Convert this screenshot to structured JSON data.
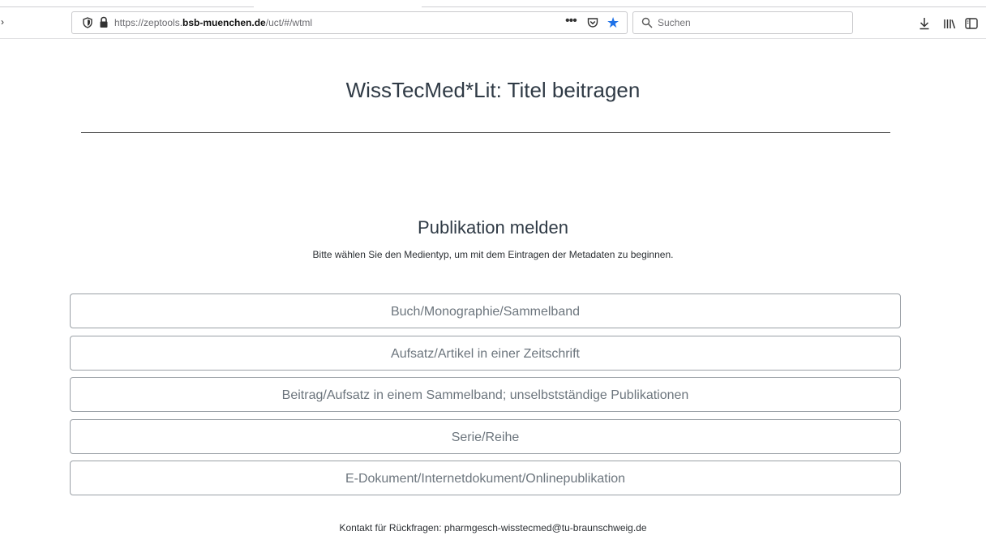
{
  "browser": {
    "url_prefix": "https://zeptools.",
    "url_domain": "bsb-muenchen.de",
    "url_path": "/uct/#/wtml",
    "more_label": "•••",
    "search_placeholder": "Suchen",
    "colors": {
      "star": "#1f72e8"
    }
  },
  "page": {
    "title": "WissTecMed*Lit: Titel beitragen",
    "section_title": "Publikation melden",
    "section_subtitle": "Bitte wählen Sie den Medientyp, um mit dem Eintragen der Metadaten zu beginnen.",
    "options": [
      "Buch/Monographie/Sammelband",
      "Aufsatz/Artikel in einer Zeitschrift",
      "Beitrag/Aufsatz in einem Sammelband; unselbstständige Publikationen",
      "Serie/Reihe",
      "E-Dokument/Internetdokument/Onlinepublikation"
    ],
    "footer": "Kontakt für Rückfragen: pharmgesch-wisstecmed@tu-braunschweig.de"
  },
  "icons": [
    "back-icon",
    "shield-icon",
    "lock-icon",
    "more-icon",
    "pocket-icon",
    "star-icon",
    "search-icon",
    "download-icon",
    "library-icon",
    "sidebar-icon"
  ]
}
